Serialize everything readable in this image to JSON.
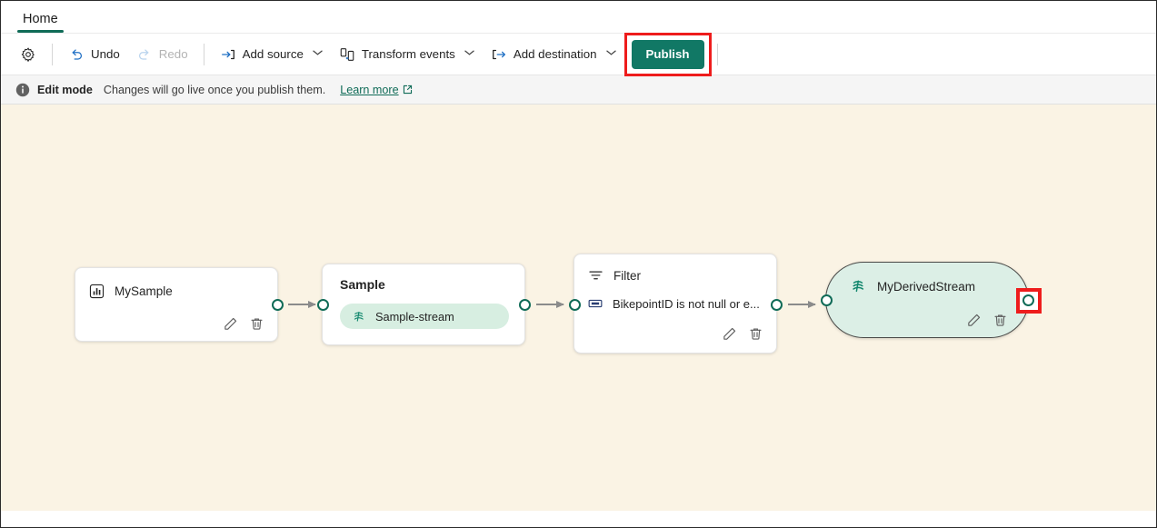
{
  "window": {
    "tabs": [
      {
        "label": "Home",
        "active": true
      }
    ]
  },
  "toolbar": {
    "settings_icon": "gear-icon",
    "undo_label": "Undo",
    "undo_icon": "undo-arrow-icon",
    "redo_label": "Redo",
    "redo_icon": "redo-arrow-icon",
    "add_source_label": "Add source",
    "add_source_icon": "arrow-into-bracket-icon",
    "transform_events_label": "Transform events",
    "transform_events_icon": "transform-events-icon",
    "add_destination_label": "Add destination",
    "add_destination_icon": "arrow-out-of-bracket-icon",
    "publish_label": "Publish",
    "publish_color": "#117865",
    "chevron": "⌄",
    "highlight_color": "#ee1c1c"
  },
  "messagebar": {
    "info_icon": "info-circle-icon",
    "title": "Edit mode",
    "text": "Changes will go live once you publish them.",
    "link_label": "Learn more",
    "link_icon": "external-link-icon",
    "link_color": "#0f6b57"
  },
  "canvas": {
    "background_color": "#faf3e4",
    "nodes": [
      {
        "id": "mysample",
        "type": "eventstream-source",
        "icon": "bar-chart-icon",
        "title": "MySample",
        "edit_icon": "pencil-icon",
        "delete_icon": "trash-icon"
      },
      {
        "id": "sample",
        "type": "eventstream",
        "title": "Sample",
        "stream_icon": "stream-icon",
        "stream_label": "Sample-stream"
      },
      {
        "id": "filter",
        "type": "operator-filter",
        "icon": "filter-funnel-icon",
        "title": "Filter",
        "condition_icon": "condition-field-icon",
        "condition": "BikepointID is not null or e...",
        "edit_icon": "pencil-icon",
        "delete_icon": "trash-icon"
      },
      {
        "id": "derived",
        "type": "derived-stream",
        "icon": "stream-icon",
        "title": "MyDerivedStream",
        "edit_icon": "pencil-icon",
        "delete_icon": "trash-icon",
        "output_port_highlighted": true
      }
    ],
    "port_color": "#0f6b57",
    "connector_color": "#8b8b8b"
  }
}
